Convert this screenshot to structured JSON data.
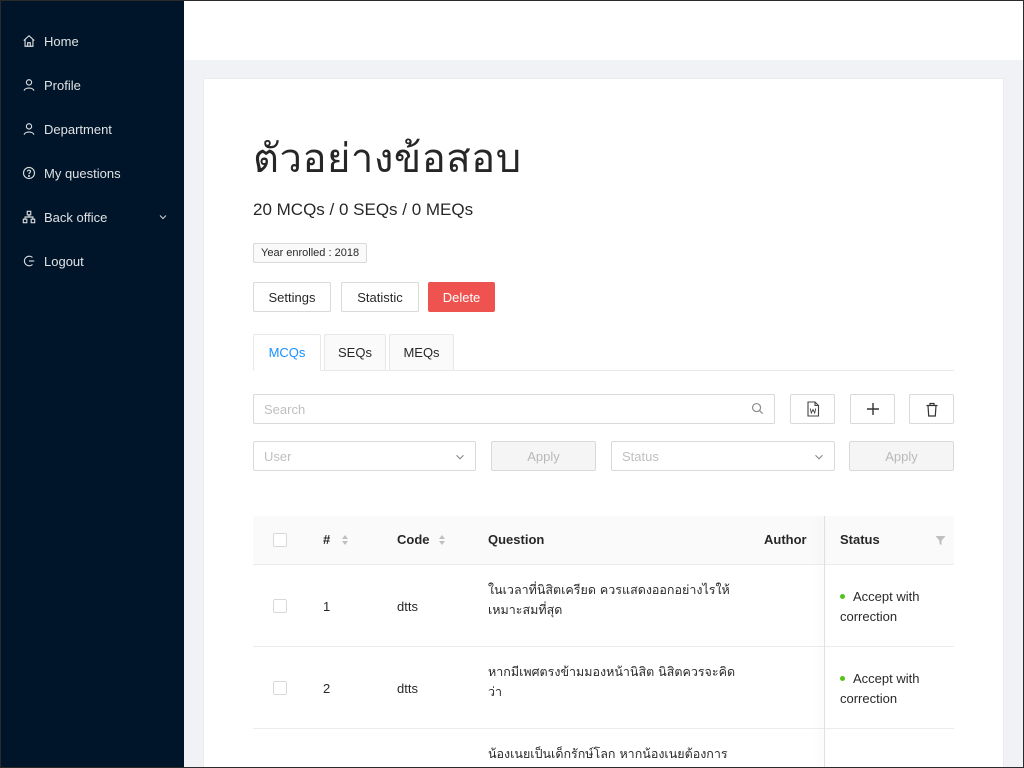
{
  "sidebar": {
    "items": [
      {
        "label": "Home",
        "icon": "home-icon"
      },
      {
        "label": "Profile",
        "icon": "user-icon"
      },
      {
        "label": "Department",
        "icon": "user-icon"
      },
      {
        "label": "My questions",
        "icon": "question-circle-icon"
      },
      {
        "label": "Back office",
        "icon": "org-chart-icon",
        "expandable": true
      },
      {
        "label": "Logout",
        "icon": "logout-icon"
      }
    ]
  },
  "page": {
    "title": "ตัวอย่างข้อสอบ",
    "summary": "20 MCQs / 0 SEQs / 0 MEQs",
    "tag": "Year enrolled : 2018"
  },
  "actions": {
    "settings": "Settings",
    "statistic": "Statistic",
    "delete": "Delete"
  },
  "tabs": [
    "MCQs",
    "SEQs",
    "MEQs"
  ],
  "active_tab": "MCQs",
  "filters": {
    "search_placeholder": "Search",
    "user_placeholder": "User",
    "status_placeholder": "Status",
    "apply_label": "Apply"
  },
  "table": {
    "columns": [
      "#",
      "Code",
      "Question",
      "Author",
      "Status"
    ],
    "rows": [
      {
        "num": "1",
        "code": "dtts",
        "question": "ในเวลาที่นิสิตเครียด ควรแสดงออกอย่างไรให้เหมาะสมที่สุด",
        "author": "",
        "status": "Accept with correction"
      },
      {
        "num": "2",
        "code": "dtts",
        "question": "หากมีเพศตรงข้ามมองหน้านิสิต นิสิตควรจะคิดว่า",
        "author": "",
        "status": "Accept with correction"
      },
      {
        "num": "",
        "code": "",
        "question": "น้องเนยเป็นเด็กรักษ์โลก หากน้องเนยต้องการ",
        "author": "",
        "status": ""
      }
    ]
  },
  "colors": {
    "sidebar_bg": "#001529",
    "accent": "#1890ff",
    "danger": "#ef5350",
    "status_ok": "#52c41a"
  }
}
